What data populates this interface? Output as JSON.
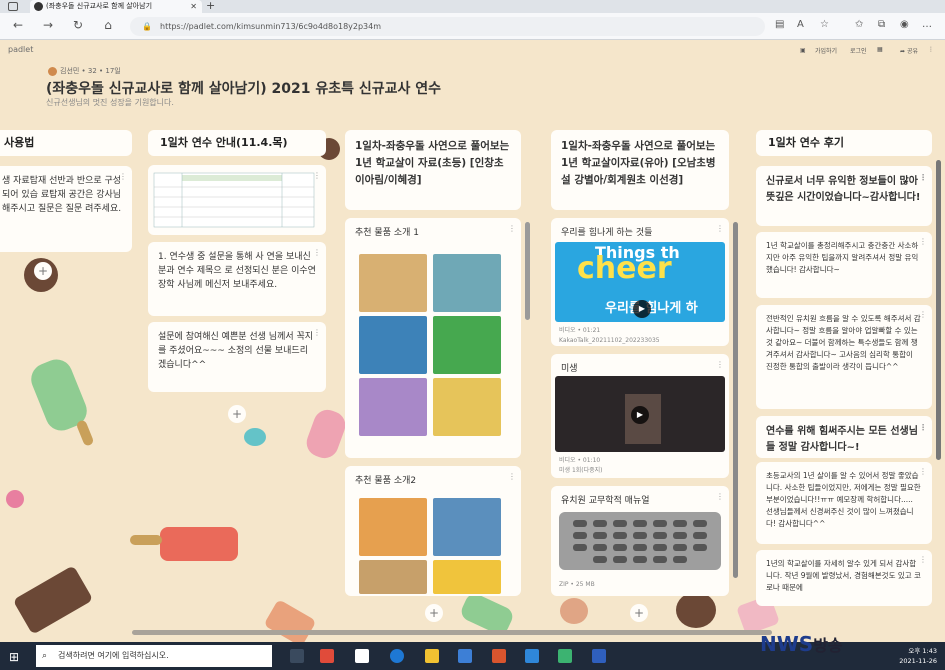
{
  "browser": {
    "tab_title": "(좌충우돌 신규교사로 함께 살아남기",
    "url": "https://padlet.com/kimsunmin713/6c9o4d8o18y2p34m"
  },
  "padlet": {
    "logo": "padlet",
    "sign_up": "가입하기",
    "log_in": "로그인",
    "share": "공유",
    "author": "김선민 • 32 • 17일",
    "title": "(좌충우돌 신규교사로 함께 살아남기) 2021 유초특 신규교사 연수",
    "subtitle": "신규선생님의 멋진 성장을 기원합니다."
  },
  "columns": [
    {
      "header": "사용법",
      "cards": [
        {
          "text": "생 자료탑재 선반과 반으로 구성되어 있습 료탑재 공간은 강사님 해주시고 질문은 질문 려주세요."
        }
      ]
    },
    {
      "header": "1일차 연수 안내(11.4.목)",
      "cards": [
        {
          "text": "1. 연수생 중 설문을 통해 사 연을 보내신 분과 연수 제목으 로 선정되신 분은 이수연장학 사님께 메신저 보내주세요."
        },
        {
          "text": "설문에 참여해신 예쁜분 선생 님께서 꼭지를 주셨어요~~~ 소정의 선물 보내드리겠습니다^^"
        }
      ]
    },
    {
      "header": "1일차-좌충우돌 사연으로 풀어보는 1년 학교살이 자료(초등) [인창초 이아림/이혜경]",
      "cards": [
        {
          "title": "추천 물품 소개 1"
        },
        {
          "title": "추천 물품 소개2"
        }
      ]
    },
    {
      "header": "1일차-좌충우돌 사연으로 풀어보는 1년 학교살이자료(유아) [오남초병설 강별아/회계원초 이선경]",
      "cards": [
        {
          "title": "우리를 힘나게 하는 것들",
          "thumb_text": "Things th",
          "thumb_big": "cheer",
          "thumb_sub": "우리를 힘나게 하",
          "caption": "비디오 • 01:21",
          "file": "KakaoTalk_20211102_202233035"
        },
        {
          "title": "미생",
          "caption": "비디오 • 01:10",
          "file": "미생 1회(다중지)"
        },
        {
          "title": "유치원 교무학적 매뉴얼",
          "caption": "ZIP • 25 MB"
        }
      ]
    },
    {
      "header": "1일차 연수 후기",
      "cards": [
        {
          "text": "신규로서 너무 유익한 정보들이 많아 뜻깊은 시간이었습니다~감사합니다!"
        },
        {
          "text": "1년 학교살이를 총정리해주시고 충간충간 사소하지만 아주 유익한 팁을까지 알려주셔서 정말 유익했습니다! 감사합니다~"
        },
        {
          "text": "전반적인 유치원 흐름을 알 수 있도록 해주셔서 감사합니다~ 정말 흐름을 알아야 업알빠할 수 있는것 같아요~ 더불어 함께하는 특수생들도 함께 챙겨주셔서 감사합니다~ 고사음의 심리학 통합이 진정한 통합의 출발이라 생각이 듭니다^^"
        },
        {
          "text": "연수를 위해 힘써주시는 모든 선생님들 정말 감사합니다~!"
        },
        {
          "text": "초등교사의 1년 살이를 알 수 있어서 정말 좋았습니다. 사소한 팁들이었지만, 저에게는 정말 필요한 부분이었습니다!!ㅠㅠ 예모장께 학허합니다..... 선생님들께서 신경써주신 것이 많이 느껴졌습니다! 감사합니다^^"
        },
        {
          "text": "1년의 학교살이를 자세히 알수 있게 되서 감사합니다. 작년 9월에 발령났서, 경험해본것도 있고 코로나 때문에"
        }
      ]
    }
  ],
  "taskbar": {
    "search_placeholder": "검색하려면 여기에 입력하십시오.",
    "time": "오후 1:43",
    "date": "2021-11-26"
  },
  "watermark": {
    "brand": "NWS",
    "suffix": "방송"
  }
}
